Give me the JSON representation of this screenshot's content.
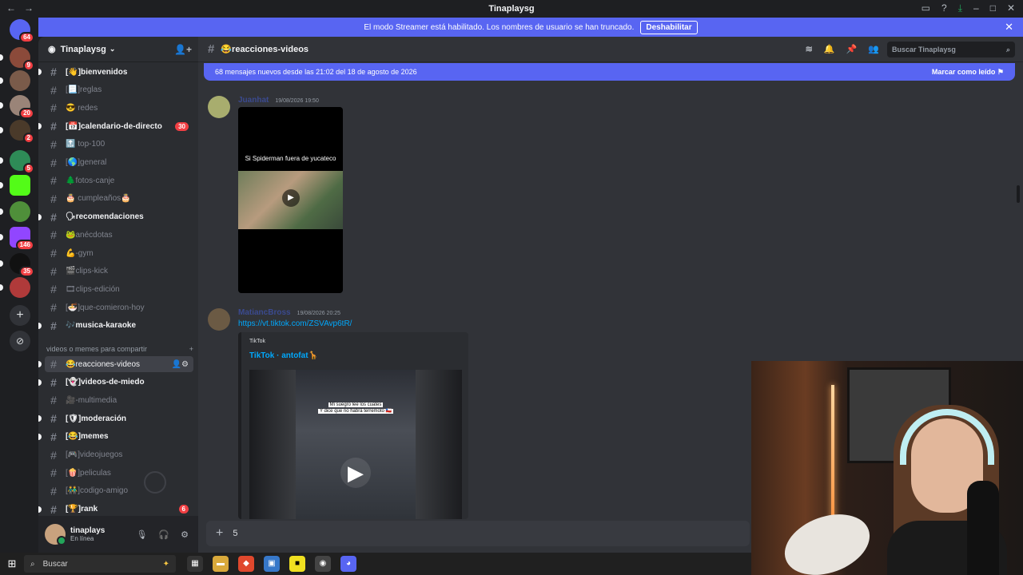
{
  "titlebar": {
    "title": "Tinaplaysg"
  },
  "servers": [
    {
      "name": "server-discord-home",
      "badge": "64",
      "color": "#5865f2"
    },
    {
      "name": "server-1",
      "badge": "9",
      "color": "#8b4a3a"
    },
    {
      "name": "server-2",
      "badge": "",
      "color": "#7a5b4a"
    },
    {
      "name": "server-3",
      "badge": "20",
      "color": "#9a8478"
    },
    {
      "name": "server-4",
      "badge": "2",
      "color": "#4a3a2a"
    },
    {
      "name": "server-5",
      "badge": "5",
      "color": "#2e8b57"
    },
    {
      "name": "server-kick",
      "badge": "",
      "color": "#53fc18"
    },
    {
      "name": "server-7",
      "badge": "",
      "color": "#4f8f3a"
    },
    {
      "name": "server-twitch",
      "badge": "146",
      "color": "#9146ff"
    },
    {
      "name": "server-9",
      "badge": "35",
      "color": "#111111"
    },
    {
      "name": "server-10",
      "badge": "",
      "color": "#b03a3a"
    }
  ],
  "banner": {
    "text": "El modo Streamer está habilitado. Los nombres de usuario se han truncado.",
    "button": "Deshabilitar"
  },
  "guild": {
    "name": "Tinaplaysg"
  },
  "channels": [
    {
      "label": "[👋]bienvenidos",
      "state": "unread",
      "badge": ""
    },
    {
      "label": "[📃]reglas",
      "state": "muted",
      "badge": ""
    },
    {
      "label": "😎 redes",
      "state": "muted",
      "badge": ""
    },
    {
      "label": "[📅]calendario-de-directo",
      "state": "unread",
      "badge": "30"
    },
    {
      "label": "🔝 top-100",
      "state": "muted",
      "badge": ""
    },
    {
      "label": "[🌎]general",
      "state": "muted",
      "badge": ""
    },
    {
      "label": "🌲fotos-canje",
      "state": "muted",
      "badge": ""
    },
    {
      "label": "🎂 cumpleaños🎂",
      "state": "muted",
      "badge": ""
    },
    {
      "label": "🗣recomendaciones",
      "state": "unread",
      "badge": ""
    },
    {
      "label": "🐸anécdotas",
      "state": "muted",
      "badge": ""
    },
    {
      "label": "💪-gym",
      "state": "muted",
      "badge": ""
    },
    {
      "label": "🎬clips-kick",
      "state": "muted",
      "badge": ""
    },
    {
      "label": "🎞clips-edición",
      "state": "muted",
      "badge": ""
    },
    {
      "label": "[🍜]que-comieron-hoy",
      "state": "muted",
      "badge": ""
    },
    {
      "label": "🎶musica-karaoke",
      "state": "unread",
      "badge": ""
    }
  ],
  "category": {
    "label": "videos o memes para compartir"
  },
  "channels2": [
    {
      "label": "😂reacciones-videos",
      "state": "active",
      "badge": ""
    },
    {
      "label": "[👻]videos-de-miedo",
      "state": "unread",
      "badge": ""
    },
    {
      "label": "🎥-multimedia",
      "state": "muted",
      "badge": ""
    },
    {
      "label": "[🛡]moderación",
      "state": "unread",
      "badge": ""
    },
    {
      "label": "[😂]memes",
      "state": "unread",
      "badge": ""
    },
    {
      "label": "[🎮]videojuegos",
      "state": "muted",
      "badge": ""
    },
    {
      "label": "[🍿]peliculas",
      "state": "muted",
      "badge": ""
    },
    {
      "label": "[👬]codigo-amigo",
      "state": "muted",
      "badge": ""
    },
    {
      "label": "[🏆]rank",
      "state": "unread",
      "badge": "6"
    }
  ],
  "user": {
    "name": "tinaplays",
    "status": "En línea"
  },
  "channel_header": {
    "name": "😂reacciones-videos",
    "search_placeholder": "Buscar Tinaplaysg"
  },
  "new_messages": {
    "text": "68 mensajes nuevos desde las 21:02 del 18 de agosto de 2026",
    "mark_read": "Marcar como leído"
  },
  "messages": [
    {
      "author": "Juanhat",
      "time": "19/08/2026 19:50",
      "video_caption": "Si Spiderman fuera de yucateco"
    },
    {
      "author": "MatiancBross",
      "time": "19/08/2026 20:25",
      "link": "https://vt.tiktok.com/ZSVAvp6tR/",
      "embed": {
        "provider": "TikTok",
        "title": "TikTok · antofat🦒",
        "caption_line1": "Mi suegro lee los cuates",
        "caption_line2": "Y dice que no habrá terremoto 🇨🇱"
      }
    }
  ],
  "composer": {
    "value": "5"
  },
  "taskbar": {
    "search": "Buscar"
  }
}
